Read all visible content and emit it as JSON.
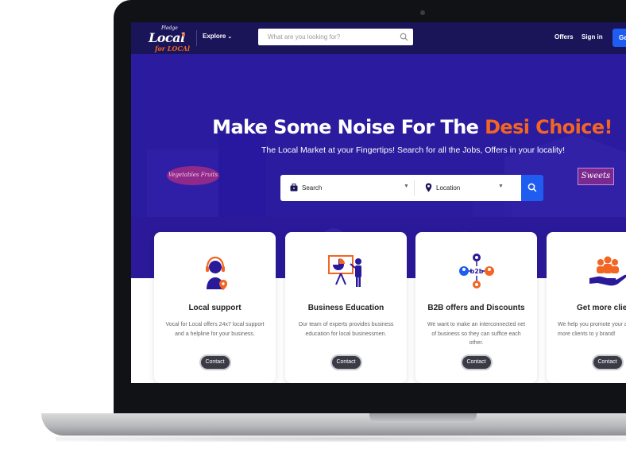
{
  "nav": {
    "logo_pledge": "Pledge",
    "logo_main": "Local",
    "logo_sub": "for LOCAl",
    "explore": "Explore",
    "search_placeholder": "What are you looking for?",
    "offers": "Offers",
    "signin": "Sign in",
    "cta": "Ge"
  },
  "hero": {
    "title_main": "Make Some Noise For The ",
    "title_accent": "Desi Choice!",
    "subtitle": "The Local Market at your Fingertips! Search for all the Jobs, Offers in your locality!",
    "sign_left": "Vegetables Fruits",
    "sign_right": "Sweets",
    "search_label": "Search",
    "location_label": "Location"
  },
  "cards": [
    {
      "title": "Local support",
      "desc": "Vocal for Local offers 24x7 local support and a helpline for your business.",
      "button": "Contact",
      "icon": "headset-agent-icon"
    },
    {
      "title": "Business Education",
      "desc": "Our team of experts provides business education for local businessmen.",
      "button": "Contact",
      "icon": "presentation-board-icon"
    },
    {
      "title": "B2B offers and Discounts",
      "desc": "We want to make an interconnected net of business so they can suffice each other.",
      "button": "Contact",
      "icon": "b2b-network-icon"
    },
    {
      "title": "Get more clie",
      "desc": "We help you promote your and get more clients to y brand!",
      "button": "Contact",
      "icon": "hand-people-icon"
    }
  ],
  "colors": {
    "navbar": "#1a1458",
    "hero": "#2a1a9a",
    "accent": "#f26522",
    "primary": "#1f5cf0"
  }
}
